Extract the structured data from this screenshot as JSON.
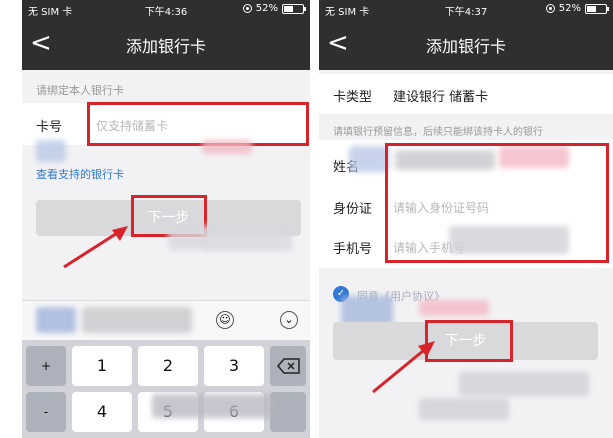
{
  "left": {
    "status": {
      "carrier": "无 SIM 卡",
      "time": "下午4:36",
      "battery": "52%",
      "battery_level": 0.52
    },
    "nav": {
      "back": "<",
      "title": "添加银行卡"
    },
    "hint": "请绑定本人银行卡",
    "card_label": "卡号",
    "card_placeholder": "仅支持储蓄卡",
    "link": "查看支持的银行卡",
    "next_button": "下一步",
    "keys": [
      "1",
      "2",
      "3",
      "4",
      "5",
      "6"
    ],
    "key_plus": "+",
    "key_minus": "-"
  },
  "right": {
    "status": {
      "carrier": "无 SIM 卡",
      "time": "下午4:37",
      "battery": "52%",
      "battery_level": 0.52
    },
    "nav": {
      "back": "<",
      "title": "添加银行卡"
    },
    "card_type_label": "卡类型",
    "card_type_value": "建设银行 储蓄卡",
    "hint": "请填银行预留信息，后续只能绑该持卡人的银行",
    "name_label": "姓名",
    "id_label": "身份证",
    "id_placeholder": "请输入身份证号码",
    "phone_label": "手机号",
    "phone_placeholder": "请输入手机号",
    "agree_text": "同意《用户协议》",
    "next_button": "下一步"
  },
  "colors": {
    "dark": "#2f2f31",
    "accent": "#d8232a",
    "link": "#2f78d6"
  }
}
